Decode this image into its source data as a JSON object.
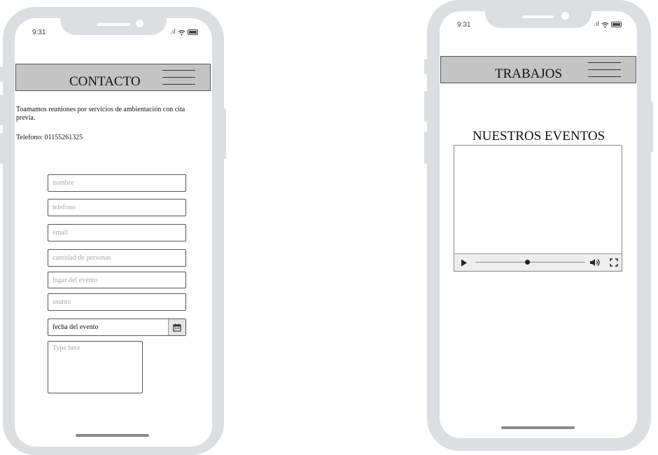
{
  "status_bar": {
    "time": "9:31",
    "signal": ".ıl"
  },
  "contact_screen": {
    "title": "CONTACTO",
    "intro": "Toamamos reuniones por servicios de ambientación con cita previa.",
    "phone": "Telefono: 01155261325",
    "fields": [
      {
        "placeholder": "nombre"
      },
      {
        "placeholder": "telefono"
      },
      {
        "placeholder": "email"
      },
      {
        "placeholder": "cantidad de personas"
      },
      {
        "placeholder": "lugar del evento"
      },
      {
        "placeholder": "asunto"
      }
    ],
    "date_field": {
      "value": "fecha del evento"
    },
    "message": {
      "placeholder": "Type here"
    }
  },
  "works_screen": {
    "title": "TRABAJOS",
    "section_title": "NUESTROS EVENTOS",
    "video": {
      "progress": 0.47
    }
  },
  "colors": {
    "frame": "#dcdee2",
    "header": "#c4c4c4"
  }
}
